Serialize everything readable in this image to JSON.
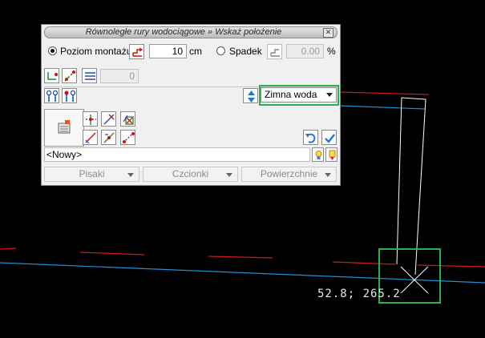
{
  "dialog": {
    "title": "Równoległe rury wodociągowe » Wskaż położenie",
    "close_icon": "close-icon"
  },
  "mounting": {
    "level_label": "Poziom montażu",
    "level_value": "10",
    "level_unit": "cm",
    "level_selected": true,
    "slope_label": "Spadek",
    "slope_value": "0.00",
    "slope_unit": "%"
  },
  "spacing": {
    "value": "0"
  },
  "medium": {
    "selected": "Zimna woda",
    "highlight_color": "#27b34a"
  },
  "selection": {
    "value": "<Nowy>"
  },
  "bottom_menu": {
    "pens": "Pisaki",
    "fonts": "Czcionki",
    "surfaces": "Powierzchnie"
  },
  "canvas": {
    "coordinate_readout": "52.8; 265.2",
    "pipe_red_color": "#d01818",
    "pipe_blue_color": "#1f8fd6",
    "cursor_color": "#ffffff"
  }
}
